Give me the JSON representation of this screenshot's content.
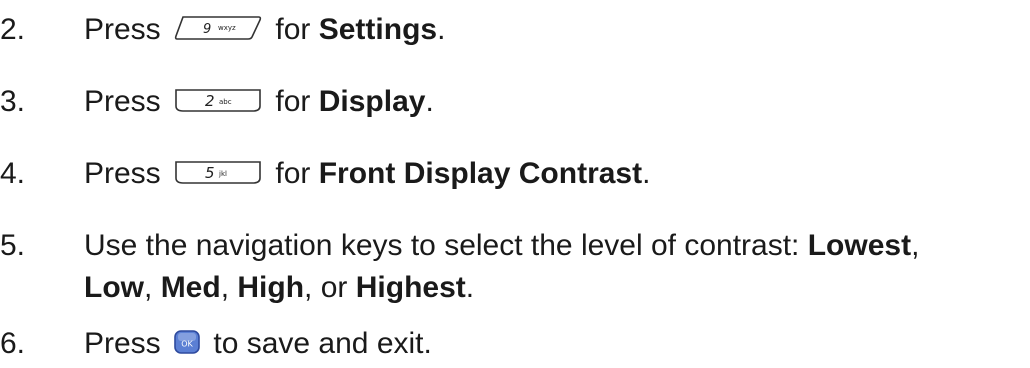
{
  "steps": [
    {
      "num": "2.",
      "pre": "Press",
      "mid": "for",
      "bold": "Settings",
      "post": ".",
      "key": {
        "digit": "9",
        "letters": "wxyz",
        "name": "9-wxyz-key-icon"
      }
    },
    {
      "num": "3.",
      "pre": "Press",
      "mid": "for",
      "bold": "Display",
      "post": ".",
      "key": {
        "digit": "2",
        "letters": "abc",
        "name": "2-abc-key-icon"
      }
    },
    {
      "num": "4.",
      "pre": "Press",
      "mid": "for",
      "bold": "Front Display Contrast",
      "post": ".",
      "key": {
        "digit": "5",
        "letters": "jkl",
        "name": "5-jkl-key-icon"
      }
    }
  ],
  "step5": {
    "num": "5.",
    "text": "Use the navigation keys to select the level of contrast:",
    "options": [
      "Lowest",
      "Low",
      "Med",
      "High",
      "Highest"
    ],
    "sep": ",",
    "or": "or",
    "post": "."
  },
  "step6": {
    "num": "6.",
    "pre": "Press",
    "post": "to save and exit.",
    "key": {
      "label": "OK",
      "name": "ok-key-icon"
    }
  },
  "colors": {
    "text": "#1a1a1a",
    "key_outline": "#333333",
    "ok_fill": "#5b7fd4",
    "ok_border": "#2e4a9e"
  }
}
